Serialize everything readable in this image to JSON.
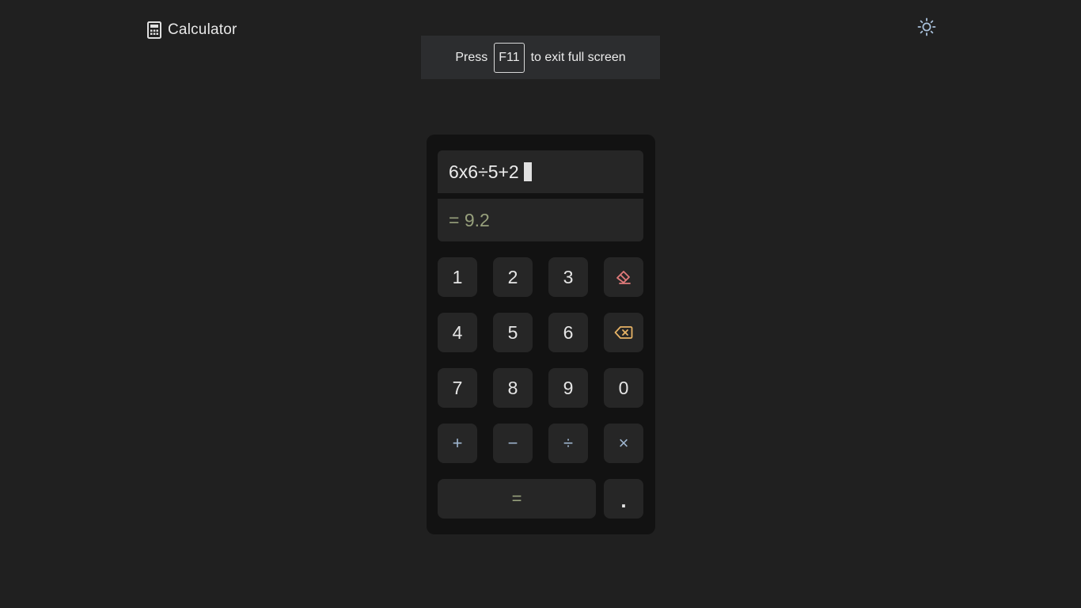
{
  "header": {
    "title": "Calculator",
    "logo_icon": "calculator-icon",
    "theme_icon": "sun-icon"
  },
  "fullscreen_notice": {
    "prefix": "Press",
    "key": "F11",
    "suffix": "to exit full screen"
  },
  "display": {
    "expression": "6x6÷5+2",
    "result": "= 9.2"
  },
  "keys": {
    "one": "1",
    "two": "2",
    "three": "3",
    "four": "4",
    "five": "5",
    "six": "6",
    "seven": "7",
    "eight": "8",
    "nine": "9",
    "zero": "0",
    "plus": "+",
    "minus": "−",
    "divide": "÷",
    "multiply": "×",
    "equals": "=",
    "dot": ".",
    "clear_icon": "eraser-icon",
    "backspace_icon": "backspace-icon"
  },
  "colors": {
    "background": "#202020",
    "panel": "#121212",
    "key": "#262626",
    "operator": "#9fb6d0",
    "result": "#97a07c",
    "clear": "#e07a7a",
    "backspace": "#e7b366"
  }
}
